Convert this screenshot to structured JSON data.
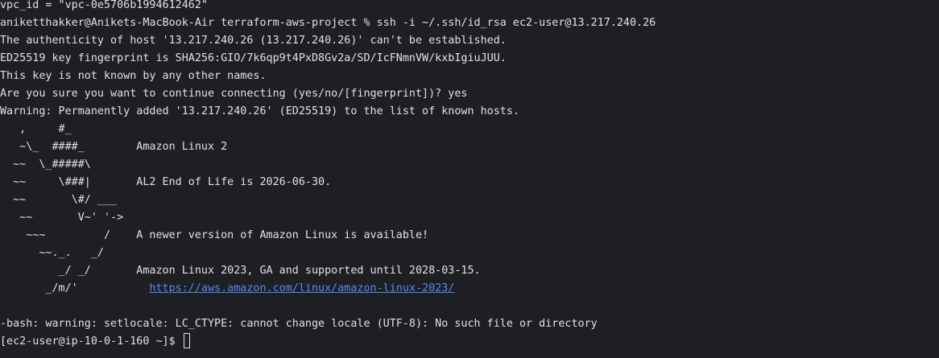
{
  "terminal": {
    "lines": [
      "vpc_id = \"vpc-0e5706b1994612462\"",
      "aniketthakker@Anikets-MacBook-Air terraform-aws-project % ssh -i ~/.ssh/id_rsa ec2-user@13.217.240.26",
      "The authenticity of host '13.217.240.26 (13.217.240.26)' can't be established.",
      "ED25519 key fingerprint is SHA256:GIO/7k6qp9t4PxD8Gv2a/SD/IcFNmnVW/kxbIgiuJUU.",
      "This key is not known by any other names.",
      "Are you sure you want to continue connecting (yes/no/[fingerprint])? yes",
      "Warning: Permanently added '13.217.240.26' (ED25519) to the list of known hosts.",
      "   ,     #_",
      "   ~\\_  ####_        Amazon Linux 2",
      "  ~~  \\_#####\\",
      "  ~~     \\###|       AL2 End of Life is 2026-06-30.",
      "  ~~       \\#/ ___",
      "   ~~       V~' '->",
      "    ~~~         /    A newer version of Amazon Linux is available!",
      "      ~~._.   _/",
      "         _/ _/       Amazon Linux 2023, GA and supported until 2028-03-15.",
      "       _/m/'           ",
      "",
      "-bash: warning: setlocale: LC_CTYPE: cannot change locale (UTF-8): No such file or directory",
      "[ec2-user@ip-10-0-1-160 ~]$ "
    ],
    "link_url": "https://aws.amazon.com/linux/amazon-linux-2023/"
  }
}
